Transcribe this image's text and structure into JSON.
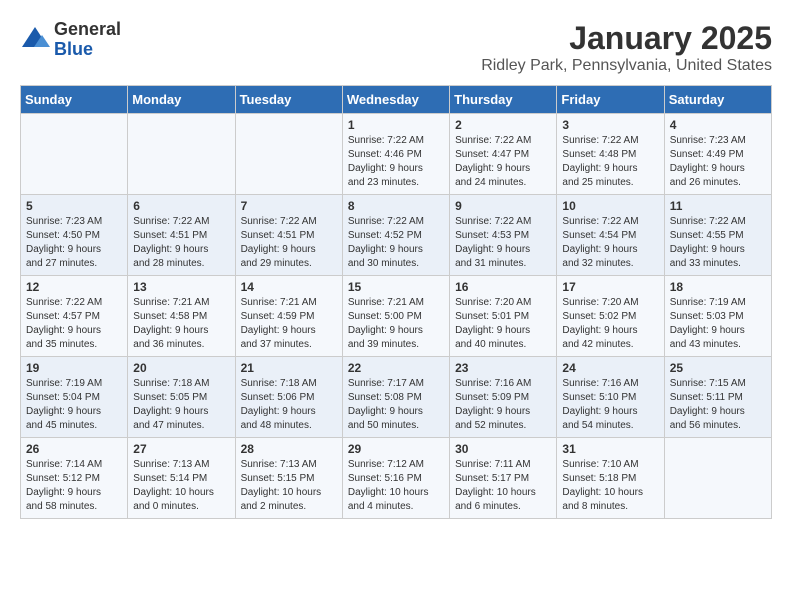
{
  "logo": {
    "general": "General",
    "blue": "Blue"
  },
  "title": "January 2025",
  "subtitle": "Ridley Park, Pennsylvania, United States",
  "headers": [
    "Sunday",
    "Monday",
    "Tuesday",
    "Wednesday",
    "Thursday",
    "Friday",
    "Saturday"
  ],
  "weeks": [
    [
      {
        "day": "",
        "info": ""
      },
      {
        "day": "",
        "info": ""
      },
      {
        "day": "",
        "info": ""
      },
      {
        "day": "1",
        "info": "Sunrise: 7:22 AM\nSunset: 4:46 PM\nDaylight: 9 hours\nand 23 minutes."
      },
      {
        "day": "2",
        "info": "Sunrise: 7:22 AM\nSunset: 4:47 PM\nDaylight: 9 hours\nand 24 minutes."
      },
      {
        "day": "3",
        "info": "Sunrise: 7:22 AM\nSunset: 4:48 PM\nDaylight: 9 hours\nand 25 minutes."
      },
      {
        "day": "4",
        "info": "Sunrise: 7:23 AM\nSunset: 4:49 PM\nDaylight: 9 hours\nand 26 minutes."
      }
    ],
    [
      {
        "day": "5",
        "info": "Sunrise: 7:23 AM\nSunset: 4:50 PM\nDaylight: 9 hours\nand 27 minutes."
      },
      {
        "day": "6",
        "info": "Sunrise: 7:22 AM\nSunset: 4:51 PM\nDaylight: 9 hours\nand 28 minutes."
      },
      {
        "day": "7",
        "info": "Sunrise: 7:22 AM\nSunset: 4:51 PM\nDaylight: 9 hours\nand 29 minutes."
      },
      {
        "day": "8",
        "info": "Sunrise: 7:22 AM\nSunset: 4:52 PM\nDaylight: 9 hours\nand 30 minutes."
      },
      {
        "day": "9",
        "info": "Sunrise: 7:22 AM\nSunset: 4:53 PM\nDaylight: 9 hours\nand 31 minutes."
      },
      {
        "day": "10",
        "info": "Sunrise: 7:22 AM\nSunset: 4:54 PM\nDaylight: 9 hours\nand 32 minutes."
      },
      {
        "day": "11",
        "info": "Sunrise: 7:22 AM\nSunset: 4:55 PM\nDaylight: 9 hours\nand 33 minutes."
      }
    ],
    [
      {
        "day": "12",
        "info": "Sunrise: 7:22 AM\nSunset: 4:57 PM\nDaylight: 9 hours\nand 35 minutes."
      },
      {
        "day": "13",
        "info": "Sunrise: 7:21 AM\nSunset: 4:58 PM\nDaylight: 9 hours\nand 36 minutes."
      },
      {
        "day": "14",
        "info": "Sunrise: 7:21 AM\nSunset: 4:59 PM\nDaylight: 9 hours\nand 37 minutes."
      },
      {
        "day": "15",
        "info": "Sunrise: 7:21 AM\nSunset: 5:00 PM\nDaylight: 9 hours\nand 39 minutes."
      },
      {
        "day": "16",
        "info": "Sunrise: 7:20 AM\nSunset: 5:01 PM\nDaylight: 9 hours\nand 40 minutes."
      },
      {
        "day": "17",
        "info": "Sunrise: 7:20 AM\nSunset: 5:02 PM\nDaylight: 9 hours\nand 42 minutes."
      },
      {
        "day": "18",
        "info": "Sunrise: 7:19 AM\nSunset: 5:03 PM\nDaylight: 9 hours\nand 43 minutes."
      }
    ],
    [
      {
        "day": "19",
        "info": "Sunrise: 7:19 AM\nSunset: 5:04 PM\nDaylight: 9 hours\nand 45 minutes."
      },
      {
        "day": "20",
        "info": "Sunrise: 7:18 AM\nSunset: 5:05 PM\nDaylight: 9 hours\nand 47 minutes."
      },
      {
        "day": "21",
        "info": "Sunrise: 7:18 AM\nSunset: 5:06 PM\nDaylight: 9 hours\nand 48 minutes."
      },
      {
        "day": "22",
        "info": "Sunrise: 7:17 AM\nSunset: 5:08 PM\nDaylight: 9 hours\nand 50 minutes."
      },
      {
        "day": "23",
        "info": "Sunrise: 7:16 AM\nSunset: 5:09 PM\nDaylight: 9 hours\nand 52 minutes."
      },
      {
        "day": "24",
        "info": "Sunrise: 7:16 AM\nSunset: 5:10 PM\nDaylight: 9 hours\nand 54 minutes."
      },
      {
        "day": "25",
        "info": "Sunrise: 7:15 AM\nSunset: 5:11 PM\nDaylight: 9 hours\nand 56 minutes."
      }
    ],
    [
      {
        "day": "26",
        "info": "Sunrise: 7:14 AM\nSunset: 5:12 PM\nDaylight: 9 hours\nand 58 minutes."
      },
      {
        "day": "27",
        "info": "Sunrise: 7:13 AM\nSunset: 5:14 PM\nDaylight: 10 hours\nand 0 minutes."
      },
      {
        "day": "28",
        "info": "Sunrise: 7:13 AM\nSunset: 5:15 PM\nDaylight: 10 hours\nand 2 minutes."
      },
      {
        "day": "29",
        "info": "Sunrise: 7:12 AM\nSunset: 5:16 PM\nDaylight: 10 hours\nand 4 minutes."
      },
      {
        "day": "30",
        "info": "Sunrise: 7:11 AM\nSunset: 5:17 PM\nDaylight: 10 hours\nand 6 minutes."
      },
      {
        "day": "31",
        "info": "Sunrise: 7:10 AM\nSunset: 5:18 PM\nDaylight: 10 hours\nand 8 minutes."
      },
      {
        "day": "",
        "info": ""
      }
    ]
  ]
}
